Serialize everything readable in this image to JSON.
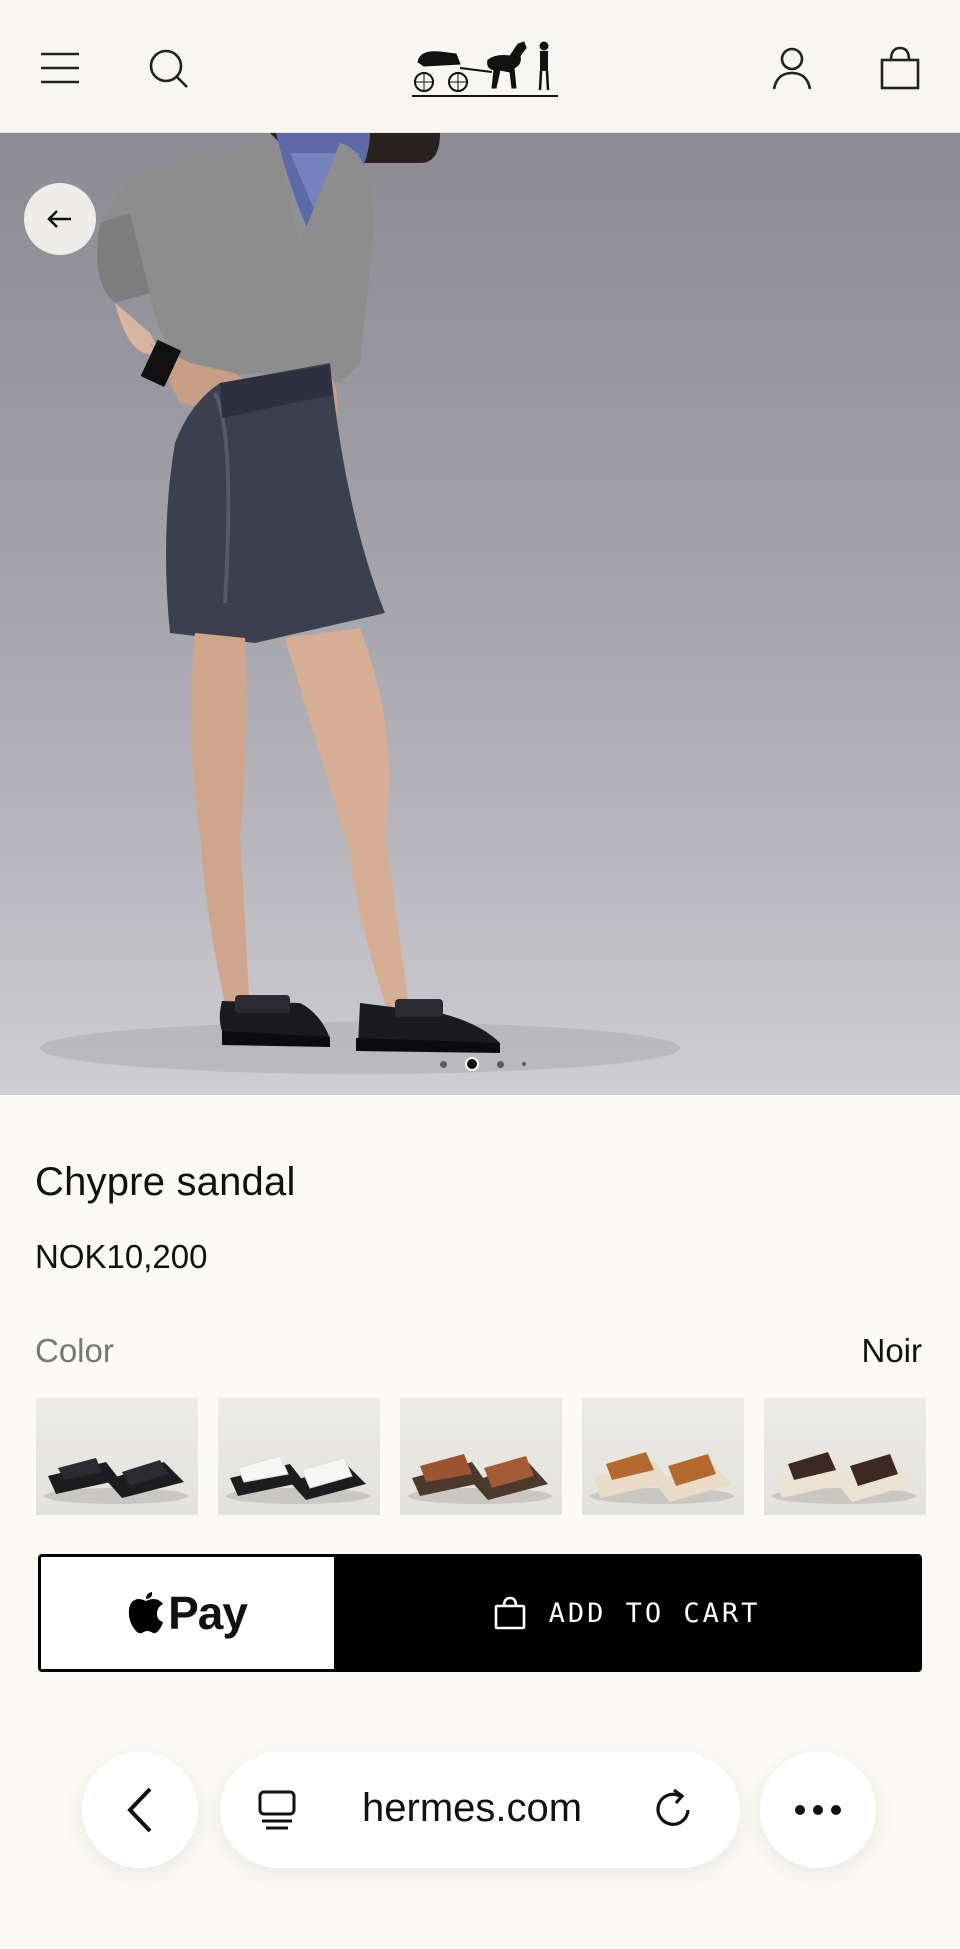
{
  "header": {
    "menu_icon": "menu-icon",
    "search_icon": "search-icon",
    "logo": "hermes-carriage-logo",
    "account_icon": "account-icon",
    "bag_icon": "shopping-bag-icon"
  },
  "gallery": {
    "back_icon": "arrow-left-icon",
    "image_count": 4,
    "active_index": 1
  },
  "product": {
    "name": "Chypre sandal",
    "price": "NOK10,200",
    "color_label": "Color",
    "color_value": "Noir",
    "swatches": [
      "Noir",
      "Blanc",
      "Brown",
      "Tan shearling",
      "Dark brown shearling"
    ]
  },
  "actions": {
    "apple_pay_label": "Pay",
    "add_to_cart_label": "ADD TO CART"
  },
  "browser": {
    "url": "hermes.com"
  },
  "colors": {
    "background": "#fcfaf4",
    "button_black": "#000000"
  }
}
